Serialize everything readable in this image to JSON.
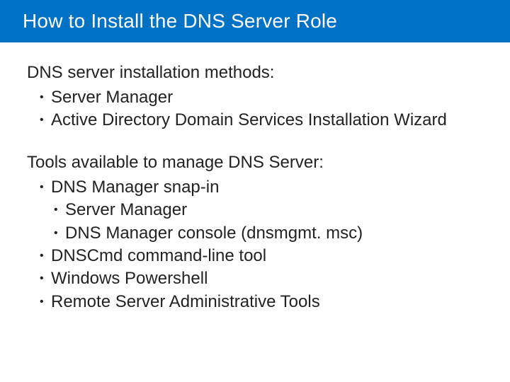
{
  "title": "How to Install the DNS Server Role",
  "section1": {
    "lead": "DNS server installation methods:",
    "items": [
      "Server Manager",
      "Active Directory Domain Services Installation Wizard"
    ]
  },
  "section2": {
    "lead": "Tools available to manage DNS Server:",
    "items": [
      {
        "text": "DNS Manager snap-in",
        "sub": [
          "Server Manager",
          "DNS Manager console (dnsmgmt. msc)"
        ]
      },
      {
        "text": "DNSCmd command-line tool"
      },
      {
        "text": "Windows Powershell"
      },
      {
        "text": "Remote Server Administrative Tools"
      }
    ]
  }
}
